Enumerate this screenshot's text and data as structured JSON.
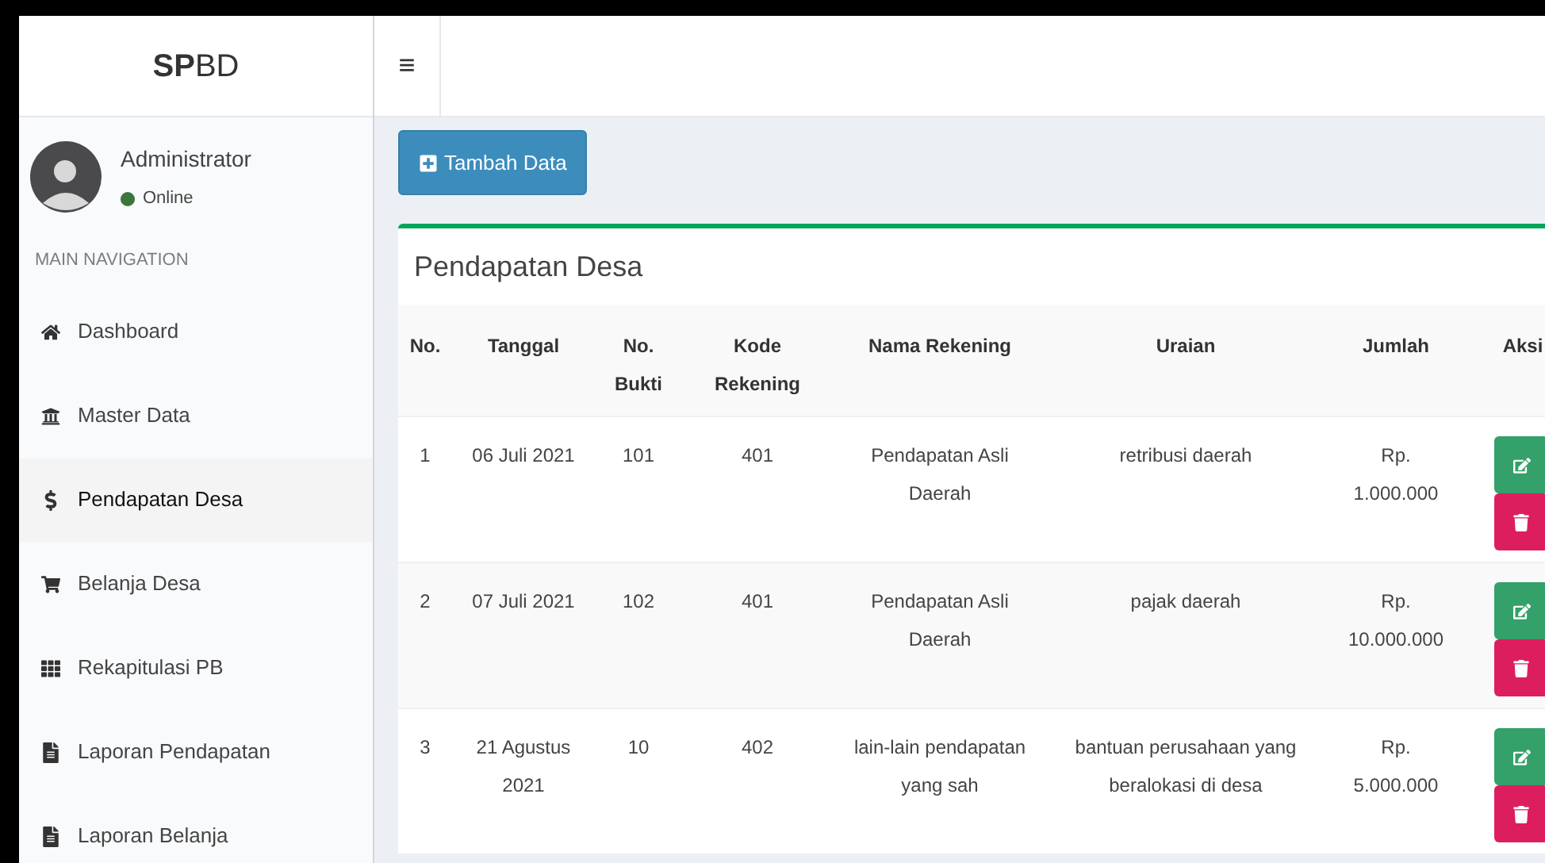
{
  "brand": "**SP**BD",
  "menu_toggle": "≡",
  "user": {
    "name": "Administrator",
    "status": "Online"
  },
  "nav_header": "MAIN NAVIGATION",
  "nav": [
    {
      "label": "Dashboard",
      "selected": false
    },
    {
      "label": "Master Data",
      "selected": false
    },
    {
      "label": "Pendapatan Desa",
      "selected": true
    },
    {
      "label": "Belanja Desa",
      "selected": false
    },
    {
      "label": "Rekapitulasi PB",
      "selected": false
    },
    {
      "label": "Laporan Pendapatan",
      "selected": false
    },
    {
      "label": "Laporan Belanja",
      "selected": false
    }
  ],
  "add_button": "Tambah Data",
  "card_title": "Pendapatan Desa",
  "table": {
    "columns": [
      "No.",
      "Tanggal",
      "No. Bukti",
      "Kode Rekening",
      "Nama Rekening",
      "Uraian",
      "Jumlah",
      "Aksi"
    ],
    "rows": [
      [
        "1",
        "06 Juli 2021",
        "101",
        "401",
        "Pendapatan Asli Daerah",
        "retribusi daerah",
        "Rp. 1.000.000"
      ],
      [
        "2",
        "07 Juli 2021",
        "102",
        "401",
        "Pendapatan Asli Daerah",
        "pajak daerah",
        "Rp. 10.000.000"
      ],
      [
        "3",
        "21 Agustus 2021",
        "10",
        "402",
        "lain-lain pendapatan yang sah",
        "bantuan perusahaan yang beralokasi di desa",
        "Rp. 5.000.000"
      ]
    ]
  }
}
